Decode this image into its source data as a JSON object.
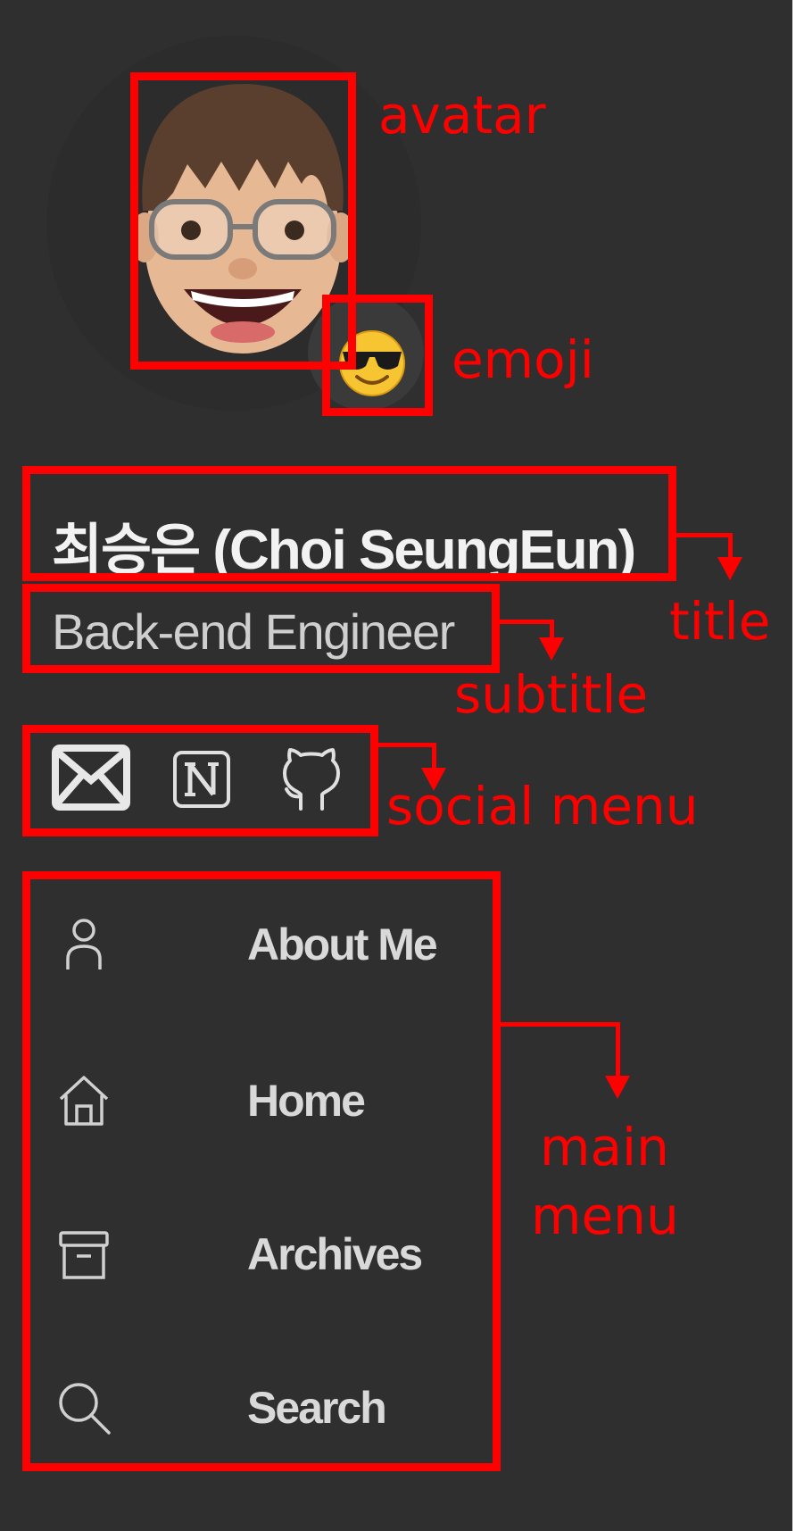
{
  "profile": {
    "title": "최승은 (Choi SeungEun)",
    "subtitle": "Back-end Engineer",
    "emoji": "😎"
  },
  "social_menu": [
    {
      "icon": "mail-icon"
    },
    {
      "icon": "notion-icon"
    },
    {
      "icon": "github-icon"
    }
  ],
  "main_menu": [
    {
      "label": "About Me",
      "icon": "person-icon"
    },
    {
      "label": "Home",
      "icon": "home-icon"
    },
    {
      "label": "Archives",
      "icon": "archive-icon"
    },
    {
      "label": "Search",
      "icon": "search-icon"
    }
  ],
  "annotations": {
    "avatar": "avatar",
    "emoji": "emoji",
    "title": "title",
    "subtitle": "subtitle",
    "social_menu": "social menu",
    "main_menu_line1": "main",
    "main_menu_line2": "menu"
  },
  "colors": {
    "background": "#2f2f2f",
    "annotation": "#ff0000",
    "title": "#f2f2f2",
    "subtitle": "#cfcfcf",
    "menu_text": "#d9d9d9"
  }
}
